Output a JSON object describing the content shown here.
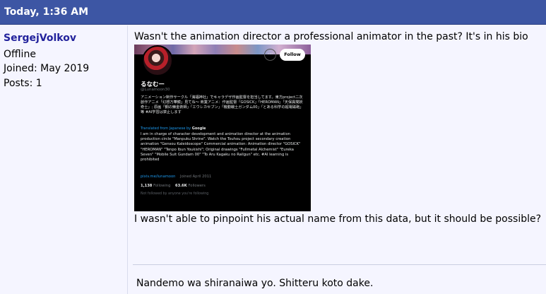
{
  "post": {
    "date": "Today, 1:36 AM"
  },
  "user": {
    "name": "SergejVolkov",
    "status": "Offline",
    "joined": "Joined: May 2019",
    "posts": "Posts: 1"
  },
  "message": {
    "line1": "Wasn't the animation director a professional animator in the past? It's in his bio",
    "line2": "I wasn't able to pinpoint his actual name from this data, but it should be possible?"
  },
  "embed": {
    "more": "···",
    "follow_label": "Follow",
    "display_name": "るなむー",
    "handle": "@Lunamoon30",
    "bio_jp": "アニメーション制作サークル「満福神社」でキャラデザ作画監督を担当してます。東方project二次創作アニメ「幻想万華鏡」見てね〜 商業アニメ：作画監督「GOSICK」「HEROMAN」「天保異聞妖奇士」; 原画「鋼の錬金術師」「エウレカセブン」「機動戦士ガンダム00」「とある科学の超電磁砲」等 #AI学習は禁止します",
    "translated_label": "Translated from Japanese by",
    "translated_by": "Google",
    "bio_en": "I am in charge of character development and animation director at the animation production circle \"Manpuku Shrine\". Watch the Touhou project secondary creation animation \"Gensou Kaleidoscope\" Commercial animation: Animation director \"GOSICK\" \"HEROMAN\" \"Tenpo Ibun Youkishi\"; Original drawings \"Fullmetal Alchemist\" \"Eureka Seven\" \"Mobile Suit Gundam 00\" \"To Aru Kagaku no Railgun\" etc. #AI learning is prohibited",
    "link": "pixiv.me/lunamoon",
    "joined": "Joined April 2011",
    "following_count": "1,138",
    "following_label": "Following",
    "followers_count": "63.6K",
    "followers_label": "Followers",
    "note": "Not followed by anyone you're following"
  },
  "signature": "Nandemo wa shiranaiwa yo. Shitteru koto dake."
}
